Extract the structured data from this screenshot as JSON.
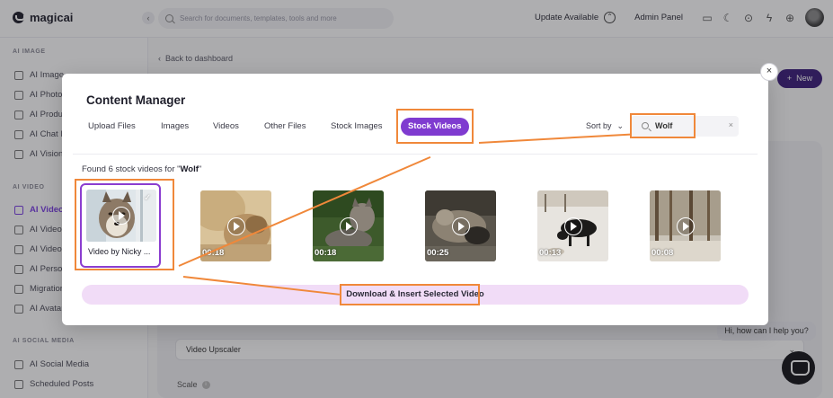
{
  "app": {
    "name": "magicai"
  },
  "topbar": {
    "search_placeholder": "Search for documents, templates, tools and more",
    "update_label": "Update Available",
    "admin_label": "Admin Panel"
  },
  "sidebar": {
    "sections": [
      "AI IMAGE",
      "AI VIDEO",
      "AI SOCIAL MEDIA"
    ],
    "image_items": [
      "AI Image",
      "AI Photo",
      "AI Produ",
      "AI Chat Ir",
      "AI Vision"
    ],
    "video_items": [
      "AI Video",
      "AI Video",
      "AI Video",
      "AI Persor",
      "Migration",
      "AI Avatar"
    ],
    "social_items": [
      "AI Social Media",
      "Scheduled Posts"
    ]
  },
  "page": {
    "back_link": "Back to dashboard",
    "new_button": "New",
    "upscaler_select": "Video Upscaler",
    "scale_label": "Scale",
    "chat_greeting": "Hi, how can I help you?"
  },
  "modal": {
    "title": "Content Manager",
    "close": "×",
    "tabs": [
      "Upload Files",
      "Images",
      "Videos",
      "Other Files",
      "Stock Images",
      "Stock Videos"
    ],
    "active_tab": "Stock Videos",
    "sort_label": "Sort by",
    "search_value": "Wolf",
    "found_prefix": "Found 6 stock videos for \"",
    "found_query": "Wolf",
    "found_suffix": "\"",
    "videos": [
      {
        "caption": "Video by Nicky ...",
        "duration": "",
        "selected": true
      },
      {
        "caption": "",
        "duration": "00:18",
        "selected": false
      },
      {
        "caption": "",
        "duration": "00:18",
        "selected": false
      },
      {
        "caption": "",
        "duration": "00:25",
        "selected": false
      },
      {
        "caption": "",
        "duration": "00:13",
        "selected": false
      },
      {
        "caption": "",
        "duration": "00:08",
        "selected": false
      }
    ],
    "action_button": "Download & Insert Selected Video"
  },
  "colors": {
    "accent": "#7f3bd0",
    "highlight": "#f0883a",
    "action_bar": "#f1dcf7"
  }
}
